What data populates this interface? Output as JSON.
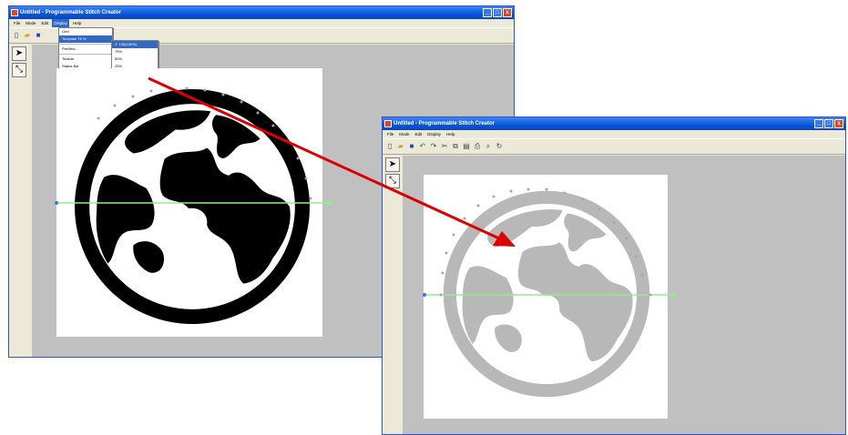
{
  "window_left": {
    "title": "Untitled - Programmable Stitch Creator",
    "menus": [
      "File",
      "Mode",
      "Edit",
      "Display",
      "Help"
    ],
    "active_menu": "Display",
    "toolbar_icons": [
      "new-icon",
      "open-icon",
      "save-icon",
      "undo-icon",
      "redo-icon",
      "cut-icon",
      "copy-icon",
      "paste-icon",
      "print-icon",
      "zoom-icon",
      "rotate-icon"
    ]
  },
  "display_menu": {
    "items": [
      "Grid",
      "Template  75  %",
      "Preview...",
      "Toolbar",
      "Status Bar"
    ],
    "submenu": [
      "✔ 100(100%)",
      "75%",
      "50%",
      "25%",
      "Off"
    ]
  },
  "window_right": {
    "title": "Untitled - Programmable Stitch Creator",
    "menus": [
      "File",
      "Mode",
      "Edit",
      "Display",
      "Help"
    ],
    "toolbar_icons": [
      "new-icon",
      "open-icon",
      "save-icon",
      "undo-icon",
      "redo-icon",
      "cut-icon",
      "copy-icon",
      "paste-icon",
      "print-icon",
      "zoom-icon",
      "rotate-icon"
    ]
  },
  "colors": {
    "titlebar": "#0a55d8",
    "workspace": "#c0c0c0",
    "globe_full": "#000000",
    "globe_faded": "#b8b8b8",
    "guide_line": "#90ee90",
    "arrow": "#dd0000",
    "points": "#c090d8"
  }
}
